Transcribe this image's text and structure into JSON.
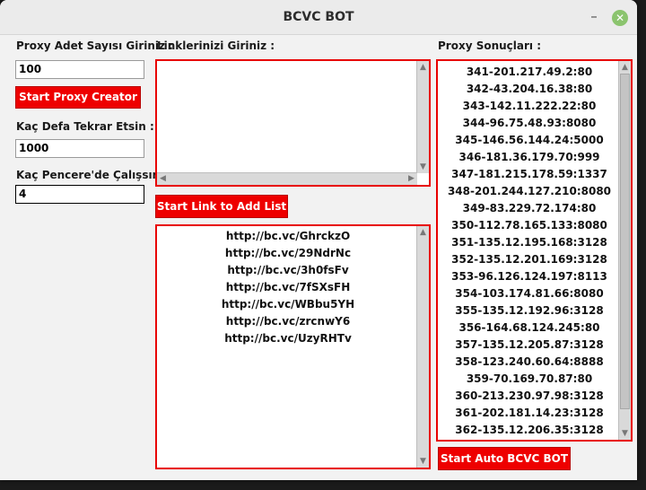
{
  "window": {
    "title": "BCVC BOT"
  },
  "left": {
    "proxy_count_label": "Proxy Adet Sayısı Giriniz :",
    "proxy_count_value": "100",
    "start_proxy_button": "Start Proxy Creator",
    "repeat_label": "Kaç Defa Tekrar Etsin :",
    "repeat_value": "1000",
    "windows_label": "Kaç Pencere'de Çalışsın :",
    "windows_value": "4"
  },
  "middle": {
    "links_label": "Linklerinizi Giriniz :",
    "links_input_value": "",
    "add_list_button": "Start Link to Add List",
    "links": [
      "http://bc.vc/GhrckzO",
      "http://bc.vc/29NdrNc",
      "http://bc.vc/3h0fsFv",
      "http://bc.vc/7fSXsFH",
      "http://bc.vc/WBbu5YH",
      "http://bc.vc/zrcnwY6",
      "http://bc.vc/UzyRHTv"
    ]
  },
  "right": {
    "results_label": "Proxy Sonuçları :",
    "proxies": [
      "341-201.217.49.2:80",
      "342-43.204.16.38:80",
      "343-142.11.222.22:80",
      "344-96.75.48.93:8080",
      "345-146.56.144.24:5000",
      "346-181.36.179.70:999",
      "347-181.215.178.59:1337",
      "348-201.244.127.210:8080",
      "349-83.229.72.174:80",
      "350-112.78.165.133:8080",
      "351-135.12.195.168:3128",
      "352-135.12.201.169:3128",
      "353-96.126.124.197:8113",
      "354-103.174.81.66:8080",
      "355-135.12.192.96:3128",
      "356-164.68.124.245:80",
      "357-135.12.205.87:3128",
      "358-123.240.60.64:8888",
      "359-70.169.70.87:80",
      "360-213.230.97.98:3128",
      "361-202.181.14.23:3128",
      "362-135.12.206.35:3128"
    ],
    "start_bot_button": "Start Auto BCVC BOT"
  },
  "icons": {
    "minimize": "minimize-icon",
    "close": "close-icon"
  },
  "colors": {
    "accent_red": "#ee0000",
    "close_green": "#8bc46e"
  }
}
